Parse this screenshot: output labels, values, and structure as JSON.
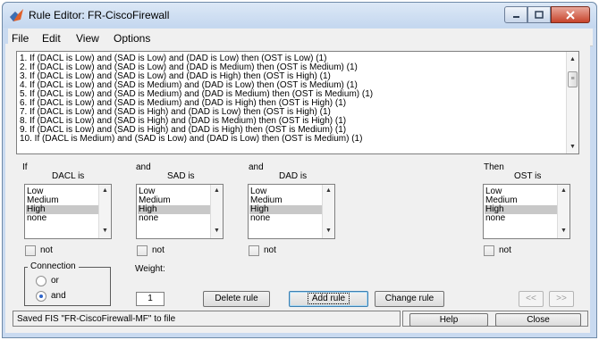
{
  "window": {
    "title": "Rule Editor: FR-CiscoFirewall"
  },
  "menu": [
    "File",
    "Edit",
    "View",
    "Options"
  ],
  "rules": [
    "1. If (DACL is Low) and (SAD is Low) and (DAD is Low) then (OST is Low) (1)",
    "2. If (DACL is Low) and (SAD is Low) and (DAD is Medium) then (OST is Medium) (1)",
    "3. If (DACL is Low) and (SAD is Low) and (DAD is High) then (OST is High) (1)",
    "4. If (DACL is Low) and (SAD is Medium) and (DAD is Low) then (OST is Medium) (1)",
    "5. If (DACL is Low) and (SAD is Medium) and (DAD is Medium) then (OST is Medium) (1)",
    "6. If (DACL is Low) and (SAD is Medium) and (DAD is High) then (OST is High) (1)",
    "7. If (DACL is Low) and (SAD is High) and (DAD is Low) then (OST is High) (1)",
    "8. If (DACL is Low) and (SAD is High) and (DAD is Medium) then (OST is High) (1)",
    "9. If (DACL is Low) and (SAD is High) and (DAD is High) then (OST is Medium) (1)",
    "10. If (DACL is Medium) and (SAD is Low) and (DAD is Low) then (OST is Medium) (1)"
  ],
  "antecedents": [
    {
      "prefix": "If",
      "name": "DACL is",
      "options": [
        "Low",
        "Medium",
        "High",
        "none"
      ],
      "selected": "High",
      "not_label": "not"
    },
    {
      "prefix": "and",
      "name": "SAD is",
      "options": [
        "Low",
        "Medium",
        "High",
        "none"
      ],
      "selected": "High",
      "not_label": "not"
    },
    {
      "prefix": "and",
      "name": "DAD is",
      "options": [
        "Low",
        "Medium",
        "High",
        "none"
      ],
      "selected": "High",
      "not_label": "not"
    }
  ],
  "consequent": {
    "prefix": "Then",
    "name": "OST is",
    "options": [
      "Low",
      "Medium",
      "High",
      "none"
    ],
    "selected": "High",
    "not_label": "not"
  },
  "connection": {
    "title": "Connection",
    "options": [
      "or",
      "and"
    ],
    "selected": "and"
  },
  "weight": {
    "label": "Weight:",
    "value": "1"
  },
  "buttons": {
    "delete": "Delete rule",
    "add": "Add rule",
    "change": "Change rule",
    "prev": "<<",
    "next": ">>",
    "help": "Help",
    "close": "Close"
  },
  "status": "Saved FIS \"FR-CiscoFirewall-MF\" to file",
  "colors": {
    "titlebar": "#c4d7ef",
    "close_button": "#c7432b",
    "selection": "#c8c8c8",
    "radio_dot": "#2e64c9"
  }
}
